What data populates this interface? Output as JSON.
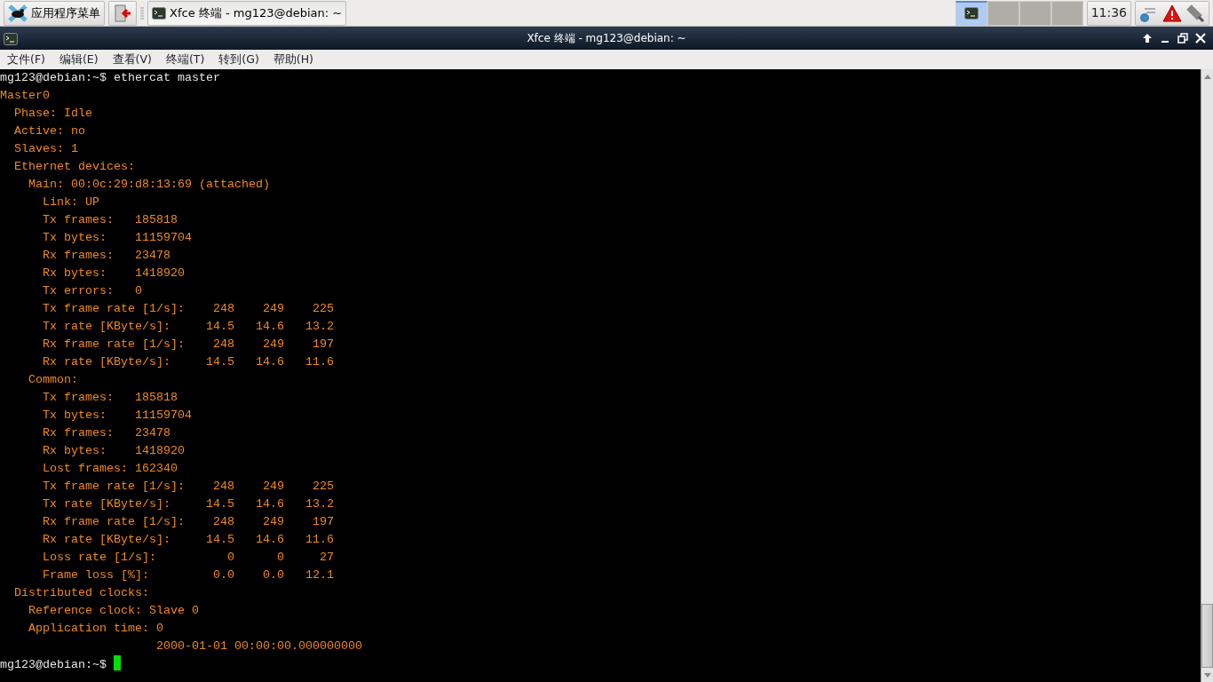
{
  "taskbar": {
    "app_menu": "应用程序菜单",
    "tasks": [
      {
        "title": "Xfce 终端 - mg123@debian: ~",
        "selected": true
      }
    ],
    "workspaces": [
      {
        "selected": true
      },
      {
        "selected": false
      },
      {
        "selected": false
      },
      {
        "selected": false
      }
    ],
    "clock": "11:36"
  },
  "window": {
    "title": "Xfce 终端 - mg123@debian: ~"
  },
  "menu": [
    "文件(F)",
    "编辑(E)",
    "查看(V)",
    "终端(T)",
    "转到(G)",
    "帮助(H)"
  ],
  "terminal": {
    "lines": [
      {
        "kind": "prompt",
        "text": "mg123@debian:~$ ethercat master"
      },
      {
        "kind": "output",
        "text": "Master0"
      },
      {
        "kind": "output",
        "text": "  Phase: Idle"
      },
      {
        "kind": "output",
        "text": "  Active: no"
      },
      {
        "kind": "output",
        "text": "  Slaves: 1"
      },
      {
        "kind": "output",
        "text": "  Ethernet devices:"
      },
      {
        "kind": "output",
        "text": "    Main: 00:0c:29:d8:13:69 (attached)"
      },
      {
        "kind": "output",
        "text": "      Link: UP"
      },
      {
        "kind": "output",
        "text": "      Tx frames:   185818"
      },
      {
        "kind": "output",
        "text": "      Tx bytes:    11159704"
      },
      {
        "kind": "output",
        "text": "      Rx frames:   23478"
      },
      {
        "kind": "output",
        "text": "      Rx bytes:    1418920"
      },
      {
        "kind": "output",
        "text": "      Tx errors:   0"
      },
      {
        "kind": "output",
        "text": "      Tx frame rate [1/s]:    248    249    225"
      },
      {
        "kind": "output",
        "text": "      Tx rate [KByte/s]:     14.5   14.6   13.2"
      },
      {
        "kind": "output",
        "text": "      Rx frame rate [1/s]:    248    249    197"
      },
      {
        "kind": "output",
        "text": "      Rx rate [KByte/s]:     14.5   14.6   11.6"
      },
      {
        "kind": "output",
        "text": "    Common:"
      },
      {
        "kind": "output",
        "text": "      Tx frames:   185818"
      },
      {
        "kind": "output",
        "text": "      Tx bytes:    11159704"
      },
      {
        "kind": "output",
        "text": "      Rx frames:   23478"
      },
      {
        "kind": "output",
        "text": "      Rx bytes:    1418920"
      },
      {
        "kind": "output",
        "text": "      Lost frames: 162340"
      },
      {
        "kind": "output",
        "text": "      Tx frame rate [1/s]:    248    249    225"
      },
      {
        "kind": "output",
        "text": "      Tx rate [KByte/s]:     14.5   14.6   13.2"
      },
      {
        "kind": "output",
        "text": "      Rx frame rate [1/s]:    248    249    197"
      },
      {
        "kind": "output",
        "text": "      Rx rate [KByte/s]:     14.5   14.6   11.6"
      },
      {
        "kind": "output",
        "text": "      Loss rate [1/s]:          0      0     27"
      },
      {
        "kind": "output",
        "text": "      Frame loss [%]:         0.0    0.0   12.1"
      },
      {
        "kind": "output",
        "text": "  Distributed clocks:"
      },
      {
        "kind": "output",
        "text": "    Reference clock: Slave 0"
      },
      {
        "kind": "output",
        "text": "    Application time: 0"
      },
      {
        "kind": "output",
        "text": "                      2000-01-01 00:00:00.000000000"
      },
      {
        "kind": "prompt",
        "text": "mg123@debian:~$",
        "cursor": true
      }
    ]
  }
}
